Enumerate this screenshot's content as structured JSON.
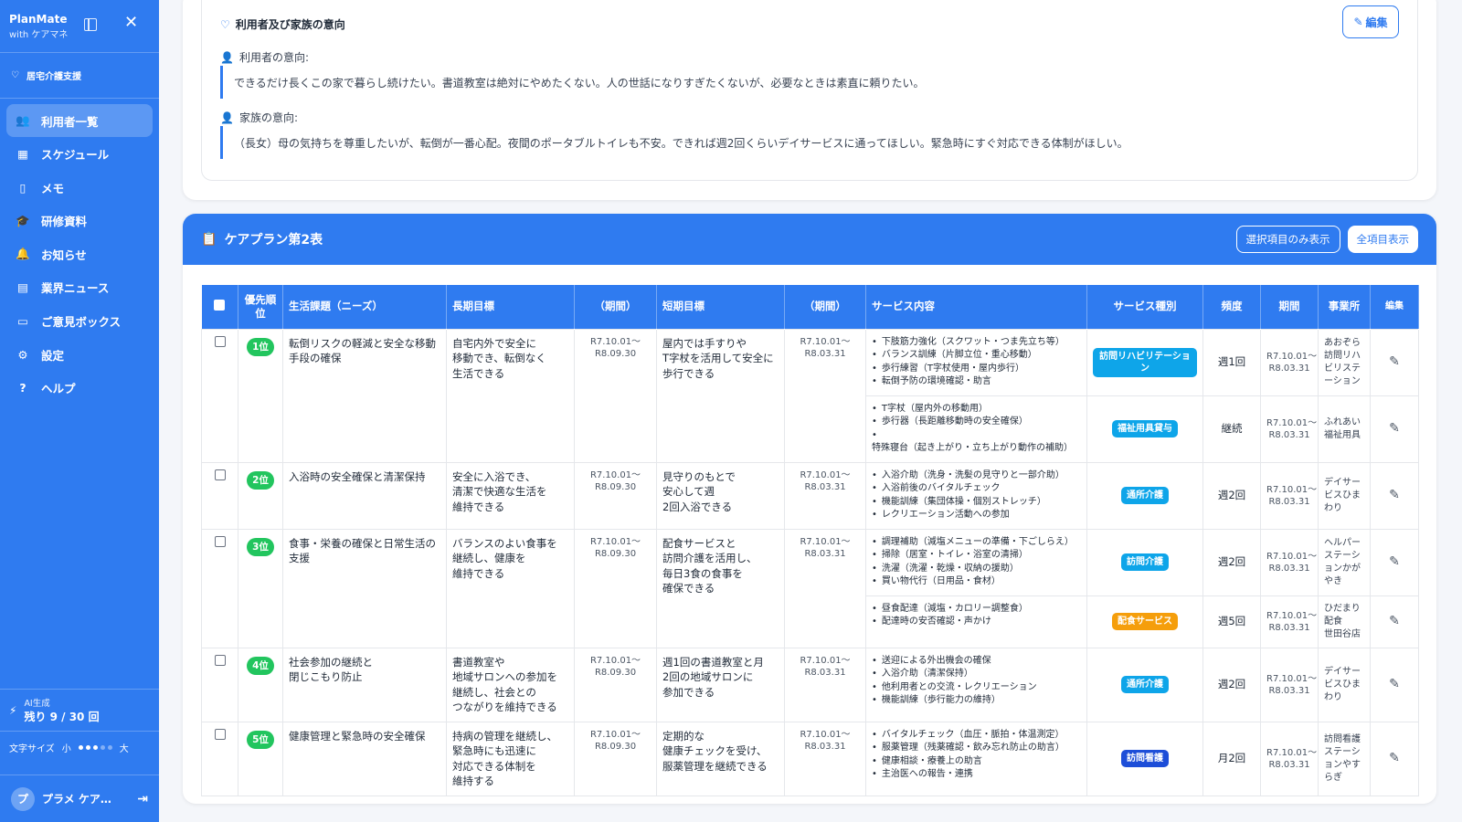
{
  "app": {
    "name": "PlanMate",
    "subtitle": "with ケアマネ"
  },
  "sidebar": {
    "section_label": "居宅介護支援",
    "items": [
      {
        "label": "利用者一覧",
        "icon": "users-icon",
        "active": true
      },
      {
        "label": "スケジュール",
        "icon": "calendar-icon",
        "active": false
      },
      {
        "label": "メモ",
        "icon": "file-icon",
        "active": false
      },
      {
        "label": "研修資料",
        "icon": "graduation-cap-icon",
        "active": false
      },
      {
        "label": "お知らせ",
        "icon": "bell-icon",
        "active": false
      },
      {
        "label": "業界ニュース",
        "icon": "newspaper-icon",
        "active": false
      },
      {
        "label": "ご意見ボックス",
        "icon": "message-icon",
        "active": false
      },
      {
        "label": "設定",
        "icon": "gear-icon",
        "active": false
      },
      {
        "label": "ヘルプ",
        "icon": "help-icon",
        "active": false
      }
    ],
    "ai": {
      "label": "AI生成",
      "value": "残り 9 / 30 回"
    },
    "fontsize": {
      "label": "文字サイズ",
      "small": "小",
      "large": "大"
    },
    "user": {
      "initial": "プ",
      "name": "プラメ ケア…"
    }
  },
  "intent": {
    "title": "利用者及び家族の意向",
    "edit_label": "編集",
    "user_label": "利用者の意向:",
    "user_text": "できるだけ長くこの家で暮らし続けたい。書道教室は絶対にやめたくない。人の世話になりすぎたくないが、必要なときは素直に頼りたい。",
    "family_label": "家族の意向:",
    "family_text": "（長女）母の気持ちを尊重したいが、転倒が一番心配。夜間のポータブルトイレも不安。できれば週2回くらいデイサービスに通ってほしい。緊急時にすぐ対応できる体制がほしい。"
  },
  "plan": {
    "title": "ケアプラン第2表",
    "btn_selected": "選択項目のみ表示",
    "btn_all": "全項目表示",
    "headers": {
      "priority": "優先順位",
      "needs": "生活課題（ニーズ）",
      "long_goal": "長期目標",
      "long_period": "（期間）",
      "short_goal": "短期目標",
      "short_period": "（期間）",
      "service": "サービス内容",
      "type": "サービス種別",
      "freq": "頻度",
      "period": "期間",
      "office": "事業所",
      "edit": "編集"
    },
    "rows": [
      {
        "priority": "1位",
        "needs": "転倒リスクの軽減と安全な移動手段の確保",
        "long_goal": "自宅内外で安全に\n移動でき、転倒なく\n生活できる",
        "long_period": "R7.10.01〜\nR8.09.30",
        "short_goal": "屋内では手すりや\nT字杖を活用して安全に\n歩行できる",
        "short_period": "R7.10.01〜\nR8.03.31",
        "services": [
          {
            "items": [
              "下肢筋力強化（スクワット・つま先立ち等）",
              "バランス訓練（片脚立位・重心移動）",
              "歩行練習（T字杖使用・屋内歩行）",
              "転倒予防の環境確認・助言"
            ],
            "type": "訪問リハビリテーション",
            "color": "#0ea5e9",
            "freq": "週1回",
            "period": "R7.10.01〜\nR8.03.31",
            "office": "あおぞら訪問リハビリステーション"
          },
          {
            "items": [
              "T字杖（屋内外の移動用）",
              "歩行器（長距離移動時の安全確保）",
              "特殊寝台（起き上がり・立ち上がり動作の補助）"
            ],
            "type": "福祉用具貸与",
            "color": "#0ea5e9",
            "freq": "継続",
            "period": "R7.10.01〜\nR8.03.31",
            "office": "ふれあい福祉用具"
          }
        ]
      },
      {
        "priority": "2位",
        "needs": "入浴時の安全確保と清潔保持",
        "long_goal": "安全に入浴でき、\n清潔で快適な生活を\n維持できる",
        "long_period": "R7.10.01〜\nR8.09.30",
        "short_goal": "見守りのもとで\n安心して週\n2回入浴できる",
        "short_period": "R7.10.01〜\nR8.03.31",
        "services": [
          {
            "items": [
              "入浴介助（洗身・洗髪の見守りと一部介助）",
              "入浴前後のバイタルチェック",
              "機能訓練（集団体操・個別ストレッチ）",
              "レクリエーション活動への参加"
            ],
            "type": "通所介護",
            "color": "#0ea5e9",
            "freq": "週2回",
            "period": "R7.10.01〜\nR8.03.31",
            "office": "デイサービスひまわり"
          }
        ]
      },
      {
        "priority": "3位",
        "needs": "食事・栄養の確保と日常生活の支援",
        "long_goal": "バランスのよい食事を\n継続し、健康を\n維持できる",
        "long_period": "R7.10.01〜\nR8.09.30",
        "short_goal": "配食サービスと\n訪問介護を活用し、\n毎日3食の食事を\n確保できる",
        "short_period": "R7.10.01〜\nR8.03.31",
        "services": [
          {
            "items": [
              "調理補助（減塩メニューの準備・下ごしらえ）",
              "掃除（居室・トイレ・浴室の清掃）",
              "洗濯（洗濯・乾燥・収納の援助）",
              "買い物代行（日用品・食材）"
            ],
            "type": "訪問介護",
            "color": "#0ea5e9",
            "freq": "週2回",
            "period": "R7.10.01〜\nR8.03.31",
            "office": "ヘルパーステーションかがやき"
          },
          {
            "items": [
              "昼食配達（減塩・カロリー調整食）",
              "配達時の安否確認・声かけ"
            ],
            "type": "配食サービス",
            "color": "#f59e0b",
            "freq": "週5回",
            "period": "R7.10.01〜\nR8.03.31",
            "office": "ひだまり配食\n世田谷店"
          }
        ]
      },
      {
        "priority": "4位",
        "needs": "社会参加の継続と\n閉じこもり防止",
        "long_goal": "書道教室や\n地域サロンへの参加を\n継続し、社会との\nつながりを維持できる",
        "long_period": "R7.10.01〜\nR8.09.30",
        "short_goal": "週1回の書道教室と月\n2回の地域サロンに\n参加できる",
        "short_period": "R7.10.01〜\nR8.03.31",
        "services": [
          {
            "items": [
              "送迎による外出機会の確保",
              "入浴介助（清潔保持）",
              "他利用者との交流・レクリエーション",
              "機能訓練（歩行能力の維持）"
            ],
            "type": "通所介護",
            "color": "#0ea5e9",
            "freq": "週2回",
            "period": "R7.10.01〜\nR8.03.31",
            "office": "デイサービスひまわり"
          }
        ]
      },
      {
        "priority": "5位",
        "needs": "健康管理と緊急時の安全確保",
        "long_goal": "持病の管理を継続し、\n緊急時にも迅速に\n対応できる体制を\n維持する",
        "long_period": "R7.10.01〜\nR8.09.30",
        "short_goal": "定期的な\n健康チェックを受け、\n服薬管理を継続できる",
        "short_period": "R7.10.01〜\nR8.03.31",
        "services": [
          {
            "items": [
              "バイタルチェック（血圧・脈拍・体温測定）",
              "服薬管理（残薬確認・飲み忘れ防止の助言）",
              "健康相談・療養上の助言",
              "主治医への報告・連携"
            ],
            "type": "訪問看護",
            "color": "#1d4ed8",
            "freq": "月2回",
            "period": "R7.10.01〜\nR8.03.31",
            "office": "訪問看護ステーションやすらぎ"
          }
        ]
      }
    ]
  }
}
